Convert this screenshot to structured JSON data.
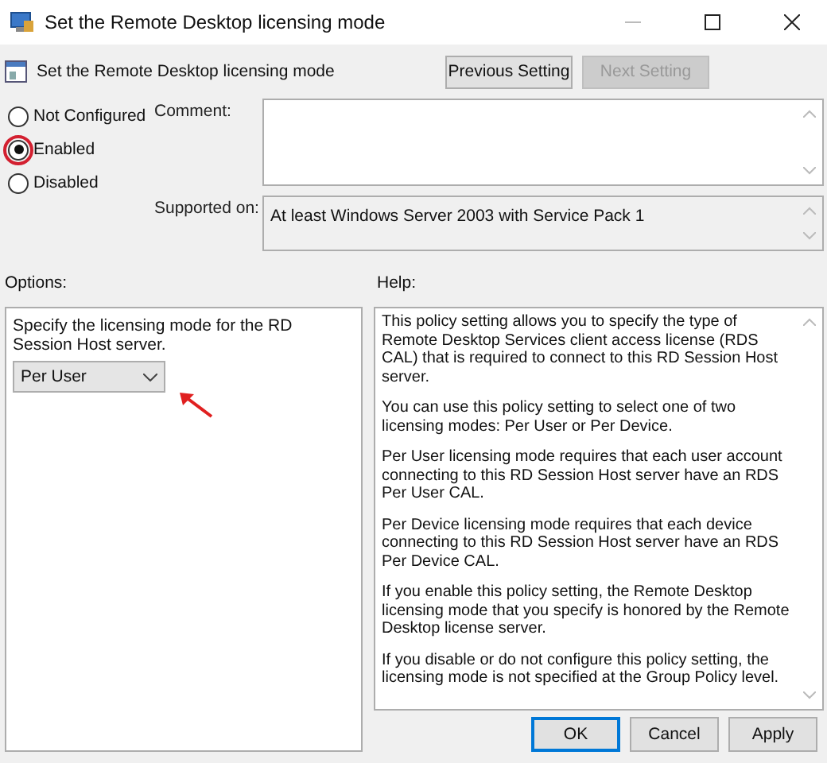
{
  "window": {
    "title": "Set the Remote Desktop licensing mode"
  },
  "header": {
    "title": "Set the Remote Desktop licensing mode",
    "buttons": [
      {
        "label": "Previous Setting",
        "disabled": false
      },
      {
        "label": "Next Setting",
        "disabled": true
      }
    ]
  },
  "state_options": [
    {
      "label": "Not Configured",
      "selected": false
    },
    {
      "label": "Enabled",
      "selected": true
    },
    {
      "label": "Disabled",
      "selected": false
    }
  ],
  "comment": {
    "label": "Comment:"
  },
  "supported_on": {
    "label": "Supported on:",
    "value": "At least Windows Server 2003 with Service Pack 1"
  },
  "options": {
    "label": "Options:",
    "description": "Specify the licensing mode for the RD Session Host server.",
    "dropdown": {
      "value": "Per User"
    }
  },
  "help": {
    "label": "Help:",
    "paragraphs": [
      "This policy setting allows you to specify the type of Remote Desktop Services client access license (RDS CAL) that is required to connect to this RD Session Host server.",
      "You can use this policy setting to select one of two licensing modes: Per User or Per Device.",
      "Per User licensing mode requires that each user account connecting to this RD Session Host server have an RDS Per User CAL.",
      "Per Device licensing mode requires that each device connecting to this RD Session Host server have an RDS Per Device CAL.",
      "If you enable this policy setting, the Remote Desktop licensing mode that you specify is honored by the Remote Desktop license server.",
      "If you disable or do not configure this policy setting, the licensing mode is not specified at the Group Policy level."
    ]
  },
  "footer_buttons": [
    {
      "label": "OK",
      "default": true
    },
    {
      "label": "Cancel",
      "default": false
    },
    {
      "label": "Apply",
      "default": false
    }
  ]
}
